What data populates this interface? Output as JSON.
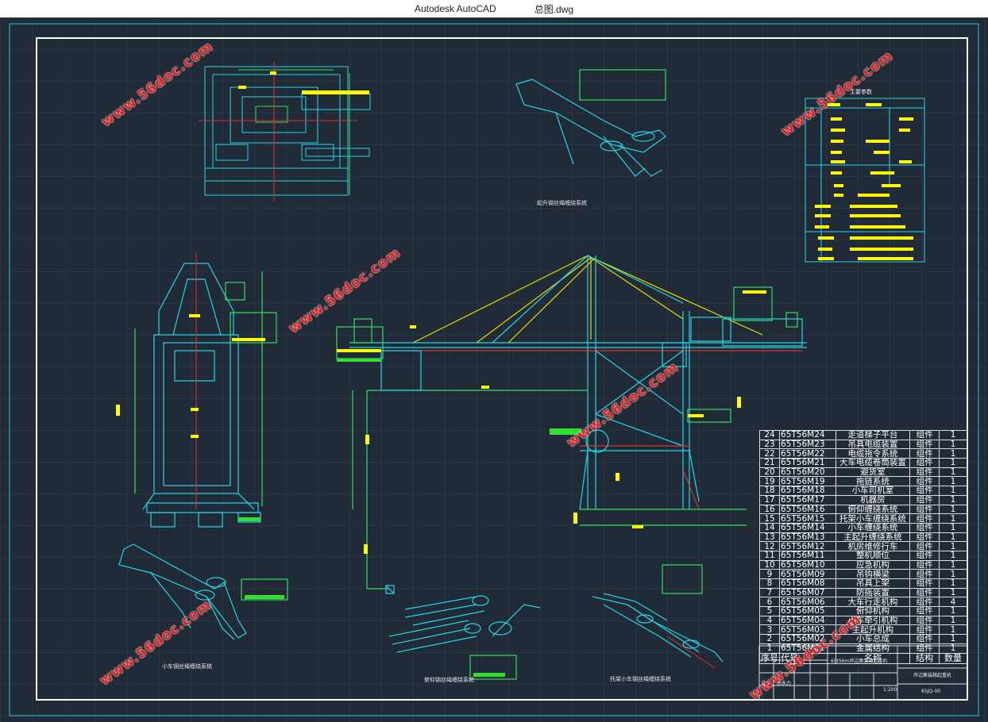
{
  "window": {
    "app_name": "Autodesk AutoCAD",
    "file_name": "总图.dwg"
  },
  "captions": {
    "lift_rope": "起升钢丝绳缠绕系统",
    "trolley_rope": "小车钢丝绳缠绕系统",
    "luffing_rope": "俯仰钢丝绳缠绕系统",
    "bracket_rope": "托架小车钢丝绳缠绕系统",
    "main_params": "主要参数"
  },
  "watermark": "www.56doc.com",
  "bom": {
    "header": {
      "no": "序号",
      "code": "代号",
      "name": "名称",
      "type": "结构",
      "qty": "数量"
    },
    "rows": [
      {
        "no": "24",
        "code": "65T56M24",
        "name": "走道梯子平台",
        "type": "组件",
        "qty": "1"
      },
      {
        "no": "23",
        "code": "65T56M23",
        "name": "吊具电缆装置",
        "type": "组件",
        "qty": "1"
      },
      {
        "no": "22",
        "code": "65T56M22",
        "name": "电缆拖令系统",
        "type": "组件",
        "qty": "1"
      },
      {
        "no": "21",
        "code": "65T56M21",
        "name": "大车电缆卷筒装置",
        "type": "组件",
        "qty": "1"
      },
      {
        "no": "20",
        "code": "65T56M20",
        "name": "避货室",
        "type": "组件",
        "qty": "1"
      },
      {
        "no": "19",
        "code": "65T56M19",
        "name": "拖链系统",
        "type": "组件",
        "qty": "1"
      },
      {
        "no": "18",
        "code": "65T56M18",
        "name": "小车司机室",
        "type": "组件",
        "qty": "1"
      },
      {
        "no": "17",
        "code": "65T56M17",
        "name": "机器房",
        "type": "组件",
        "qty": "1"
      },
      {
        "no": "16",
        "code": "65T56M16",
        "name": "俯仰缠绕系统",
        "type": "组件",
        "qty": "1"
      },
      {
        "no": "15",
        "code": "65T56M15",
        "name": "托架小车缠绕系统",
        "type": "组件",
        "qty": "1"
      },
      {
        "no": "14",
        "code": "65T56M14",
        "name": "小车缠绕系统",
        "type": "组件",
        "qty": "1"
      },
      {
        "no": "13",
        "code": "65T56M13",
        "name": "主起升缠绕系统",
        "type": "组件",
        "qty": "1"
      },
      {
        "no": "12",
        "code": "65T56M12",
        "name": "机房维修行车",
        "type": "组件",
        "qty": "1"
      },
      {
        "no": "11",
        "code": "65T56M11",
        "name": "整机顺位",
        "type": "组件",
        "qty": "1"
      },
      {
        "no": "10",
        "code": "65T56M10",
        "name": "应急机构",
        "type": "组件",
        "qty": "1"
      },
      {
        "no": "9",
        "code": "65T56M09",
        "name": "吊钩横梁",
        "type": "组件",
        "qty": "1"
      },
      {
        "no": "8",
        "code": "65T56M08",
        "name": "吊具上架",
        "type": "组件",
        "qty": "1"
      },
      {
        "no": "7",
        "code": "65T56M07",
        "name": "防摇装置",
        "type": "组件",
        "qty": "1"
      },
      {
        "no": "6",
        "code": "65T56M06",
        "name": "大车行走机构",
        "type": "组件",
        "qty": "4"
      },
      {
        "no": "5",
        "code": "65T56M05",
        "name": "俯仰机构",
        "type": "组件",
        "qty": "1"
      },
      {
        "no": "4",
        "code": "65T56M04",
        "name": "小车牵引机构",
        "type": "组件",
        "qty": "1"
      },
      {
        "no": "3",
        "code": "65T56M03",
        "name": "主起升机构",
        "type": "组件",
        "qty": "1"
      },
      {
        "no": "2",
        "code": "65T56M02",
        "name": "小车总成",
        "type": "组件",
        "qty": "1"
      },
      {
        "no": "1",
        "code": "65T56M01",
        "name": "金属结构",
        "type": "组件",
        "qty": "1"
      }
    ]
  },
  "title_block": {
    "project": "65t56m岸边集装箱起重机",
    "drawing": "岸边集装箱起重机",
    "scale": "1:200",
    "number": "65JQ-00",
    "design_label": "设计",
    "design_name": "邢永力"
  }
}
